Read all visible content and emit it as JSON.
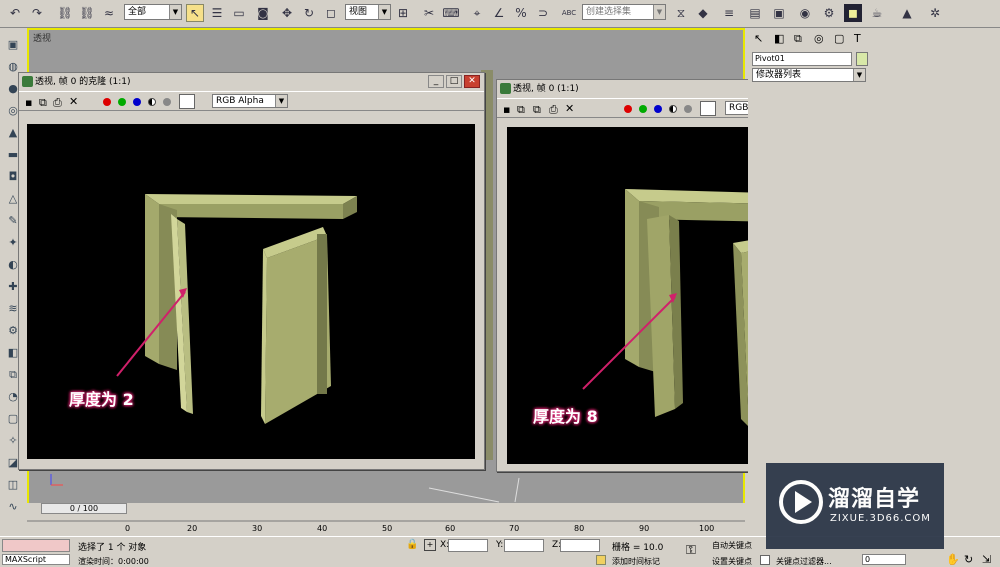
{
  "toolbar": {
    "selection_filter": "全部",
    "coord_system": "视图",
    "named_selection_placeholder": "创建选择集",
    "abc_label": "ABC"
  },
  "viewport": {
    "label": "透视"
  },
  "left_window": {
    "title": "透视, 帧 0 的克隆 (1:1)",
    "channel": "RGB Alpha",
    "annotation": "厚度为 2"
  },
  "right_window": {
    "title": "透视, 帧 0 (1:1)",
    "channel": "RGB Alpha",
    "annotation": "厚度为 8"
  },
  "command_panel": {
    "object_name": "Pivot01",
    "modifier_list": "修改器列表",
    "object_color": "#d8e8a8"
  },
  "timeline": {
    "slider_text": "0 / 100",
    "ticks": [
      "0",
      "10",
      "20",
      "30",
      "40",
      "50",
      "60",
      "70",
      "80",
      "90",
      "100"
    ]
  },
  "status": {
    "maxscript": "MAXScript",
    "selected": "选择了 1 个 对象",
    "render_time": "渲染时间：0:00:00",
    "x_label": "X:",
    "y_label": "Y:",
    "z_label": "Z:",
    "grid": "栅格 = 10.0",
    "add_time_tag": "添加时间标记",
    "auto_key": "自动关键点",
    "set_key": "设置关键点",
    "key_filter": "关键点过滤器...",
    "frame": "0"
  },
  "watermark": {
    "title": "溜溜自学",
    "url": "ZIXUE.3D66.COM"
  },
  "colors": {
    "viewport_border": "#e8e800",
    "annotation_glow": "#d0206a",
    "door_color": "#a9ae6f",
    "watermark_bg": "#2f3a4b"
  }
}
